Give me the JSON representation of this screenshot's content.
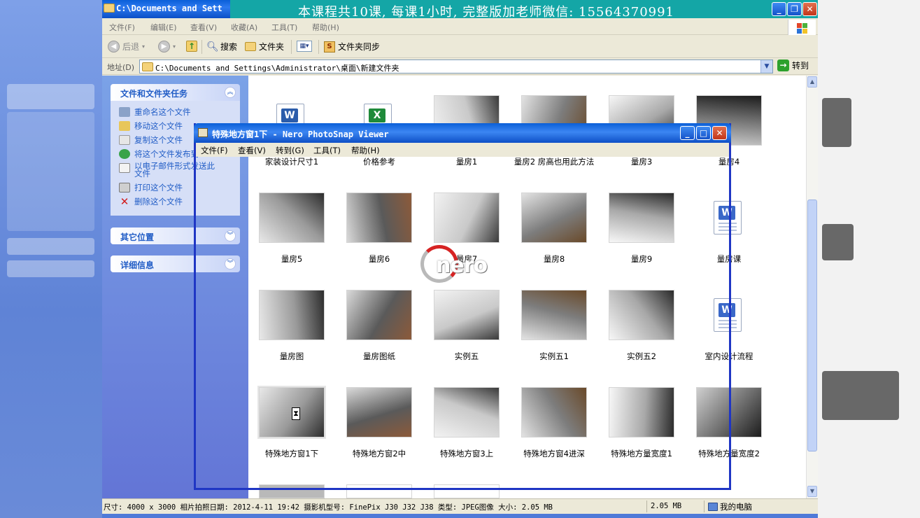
{
  "explorer": {
    "title": "C:\\Documents and Sett",
    "banner": "本课程共10课, 每课1小时, 完整版加老师微信: 15564370991",
    "menu": [
      "文件(F)",
      "编辑(E)",
      "查看(V)",
      "收藏(A)",
      "工具(T)",
      "帮助(H)"
    ],
    "toolbar": {
      "back": "后退",
      "search": "搜索",
      "folders": "文件夹",
      "sync": "文件夹同步"
    },
    "address": {
      "label": "地址(D)",
      "value": "C:\\Documents and Settings\\Administrator\\桌面\\新建文件夹",
      "go": "转到"
    },
    "taskpane": {
      "file_tasks_title": "文件和文件夹任务",
      "file_tasks": [
        "重命名这个文件",
        "移动这个文件",
        "复制这个文件",
        "将这个文件发布到 Web",
        "以电子邮件形式发送此文件",
        "打印这个文件",
        "删除这个文件"
      ],
      "other_places_title": "其它位置",
      "details_title": "详细信息"
    },
    "files": [
      {
        "name": "家装设计尺寸1",
        "kind": "word"
      },
      {
        "name": "价格参考",
        "kind": "excel"
      },
      {
        "name": "量房1",
        "kind": "photo"
      },
      {
        "name": "量房2 房高也用此方法",
        "kind": "photo"
      },
      {
        "name": "量房3",
        "kind": "photo"
      },
      {
        "name": "量房4",
        "kind": "photo"
      },
      {
        "name": "量房5",
        "kind": "photo"
      },
      {
        "name": "量房6",
        "kind": "photo"
      },
      {
        "name": "量房7",
        "kind": "photo"
      },
      {
        "name": "量房8",
        "kind": "photo"
      },
      {
        "name": "量房9",
        "kind": "photo"
      },
      {
        "name": "量房课",
        "kind": "wps"
      },
      {
        "name": "量房图",
        "kind": "photo"
      },
      {
        "name": "量房图纸",
        "kind": "photo"
      },
      {
        "name": "实例五",
        "kind": "photo"
      },
      {
        "name": "实例五1",
        "kind": "photo"
      },
      {
        "name": "实例五2",
        "kind": "photo"
      },
      {
        "name": "室内设计流程",
        "kind": "wps"
      },
      {
        "name": "特殊地方窗1下",
        "kind": "photo"
      },
      {
        "name": "特殊地方窗2中",
        "kind": "photo"
      },
      {
        "name": "特殊地方窗3上",
        "kind": "photo"
      },
      {
        "name": "特殊地方窗4进深",
        "kind": "photo"
      },
      {
        "name": "特殊地方量宽度1",
        "kind": "photo"
      },
      {
        "name": "特殊地方量宽度2",
        "kind": "photo"
      }
    ],
    "status": {
      "info": "尺寸: 4000 x 3000 相片拍照日期: 2012-4-11 19:42 摄影机型号: FinePix J30 J32 J38 类型: JPEG图像 大小: 2.05 MB",
      "size": "2.05 MB",
      "location": "我的电脑"
    }
  },
  "nero": {
    "title": "特殊地方窗1下 - Nero PhotoSnap Viewer",
    "menu": [
      "文件(F)",
      "查看(V)",
      "转到(G)",
      "工具(T)",
      "帮助(H)"
    ],
    "logo": "nero"
  },
  "colors": {
    "titlebar": "#0a5fd8",
    "banner": "#14a6a6",
    "taskpane": "#6375d6",
    "link": "#215dc6",
    "nero_frame": "#1f36c4"
  }
}
